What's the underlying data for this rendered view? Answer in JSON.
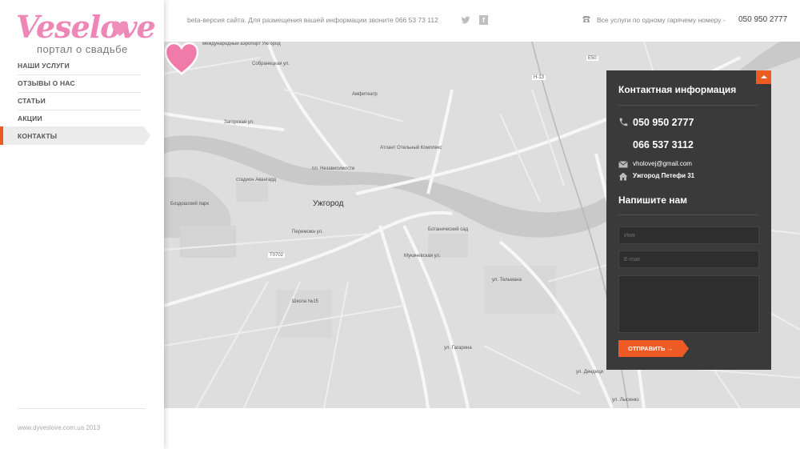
{
  "brand": {
    "logo_text": "Veselove",
    "tagline": "портал о свадьбе"
  },
  "nav": {
    "items": [
      {
        "label": "НАШИ УСЛУГИ"
      },
      {
        "label": "ОТЗЫВЫ О НАС"
      },
      {
        "label": "СТАТЬИ"
      },
      {
        "label": "АКЦИИ"
      },
      {
        "label": "КОНТАКТЫ",
        "active": true
      }
    ]
  },
  "footer": {
    "copyright": "www.dyveslove.com.ua 2013"
  },
  "topbar": {
    "close_symbol": "×",
    "beta_text": "beta-версия сайта. Для размещения вашей информации звоните 066 53 73 112",
    "hotline_text": "Все услуги по одному гарячему номеру -",
    "hotline_number": "050 950 2777",
    "facebook_glyph": "f",
    "icons": [
      "twitter-icon",
      "facebook-icon",
      "phone-icon"
    ]
  },
  "map": {
    "city_label": "Ужгород",
    "labels": [
      "международный аэропорт Ужгород",
      "Собранецкая ул.",
      "Загорская ул.",
      "Амфитеатр",
      "Атлант Отельный Комплекс",
      "стадион Авангард",
      "Боздошский парк",
      "Ботанический сад",
      "Переможн ул.",
      "Мукачевская ул.",
      "Школа №15",
      "ул. Гагарина",
      "ул. Дендеци",
      "ул. Лысенко",
      "пл. Независимости",
      "ул. Тельмана",
      "Т0702",
      "Н-13",
      "Е50"
    ],
    "accent": "#f07aa8"
  },
  "contact": {
    "title": "Контактная информация",
    "phone1": "050 950 2777",
    "phone2": "066 537 3112",
    "email": "vholovej@gmail.com",
    "address": "Ужгород Петефи 31",
    "write_title": "Напишите нам",
    "name_placeholder": "Имя",
    "email_placeholder": "E-mail",
    "message_placeholder": "",
    "send_label": "ОТПРАВИТЬ →"
  },
  "colors": {
    "accent": "#ee5a24",
    "pink": "#ee86b6",
    "panel": "#3a3a3a"
  }
}
